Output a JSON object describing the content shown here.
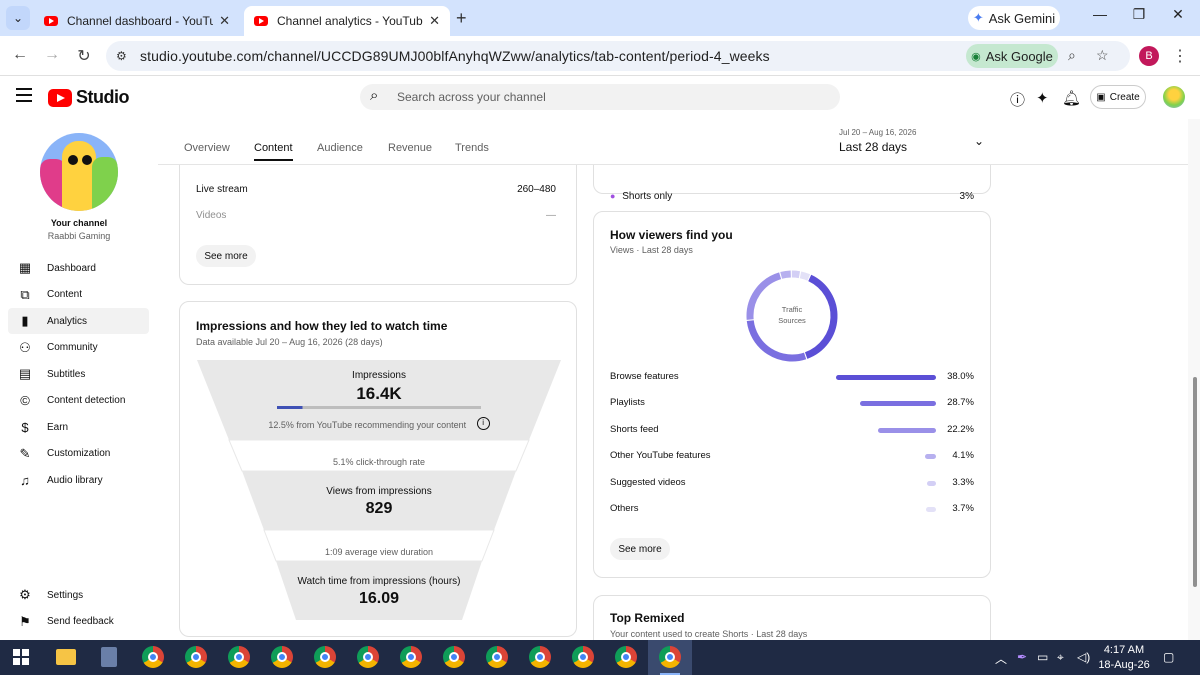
{
  "browser": {
    "tabs": [
      {
        "title": "Channel dashboard - YouTube Studio",
        "active": false
      },
      {
        "title": "Channel analytics - YouTube Studio",
        "active": true
      }
    ],
    "new_tab_icon": "plus-icon",
    "gemini_label": "Ask Gemini",
    "url": "studio.youtube.com/channel/UCCDG89UMJ00blfAnyhqWZww/analytics/tab-content/period-4_weeks",
    "ask_google_label": "Ask Google",
    "profile_initial": "B",
    "profile_color": "#c2185b"
  },
  "header": {
    "logo_text": "Studio",
    "search_placeholder": "Search across your channel",
    "create_label": "Create"
  },
  "sidebar": {
    "your_channel": "Your channel",
    "channel_name": "Raabbi Gaming",
    "items": [
      {
        "label": "Dashboard",
        "icon": "dashboard-icon"
      },
      {
        "label": "Content",
        "icon": "content-icon"
      },
      {
        "label": "Analytics",
        "icon": "analytics-icon",
        "active": true
      },
      {
        "label": "Community",
        "icon": "community-icon"
      },
      {
        "label": "Subtitles",
        "icon": "subtitles-icon"
      },
      {
        "label": "Content detection",
        "icon": "copyright-icon"
      },
      {
        "label": "Earn",
        "icon": "dollar-icon"
      },
      {
        "label": "Customization",
        "icon": "magic-wand-icon"
      },
      {
        "label": "Audio library",
        "icon": "audio-library-icon"
      }
    ],
    "bottom_items": [
      {
        "label": "Settings",
        "icon": "gear-icon"
      },
      {
        "label": "Send feedback",
        "icon": "feedback-icon"
      }
    ]
  },
  "analytics": {
    "tabs": [
      "Overview",
      "Content",
      "Audience",
      "Revenue",
      "Trends"
    ],
    "selected_tab": "Content",
    "period_range": "Jul 20 – Aug 16, 2026",
    "period_label": "Last 28 days"
  },
  "content_types": {
    "rows": [
      {
        "label": "Live stream",
        "value": "260–480"
      },
      {
        "label": "Videos",
        "value": "—"
      }
    ],
    "see_more": "See more"
  },
  "impressions": {
    "title": "Impressions and how they led to watch time",
    "subtitle": "Data available Jul 20 – Aug 16, 2026 (28 days)",
    "impressions_label": "Impressions",
    "impressions_value": "16.4K",
    "recommend_text": "12.5% from YouTube recommending your content",
    "recommend_fraction": 0.125,
    "ctr_text": "5.1% click-through rate",
    "views_label": "Views from impressions",
    "views_value": "829",
    "avd_text": "1:09 average view duration",
    "watch_label": "Watch time from impressions (hours)",
    "watch_value": "16.09"
  },
  "shorts_only": {
    "label": "Shorts only",
    "value": "3%"
  },
  "viewers": {
    "title": "How viewers find you",
    "subtitle": "Views · Last 28 days",
    "donut_label_1": "Traffic",
    "donut_label_2": "Sources",
    "sources": [
      {
        "label": "Browse features",
        "value": "38.0%",
        "pct": 38.0,
        "color": "#5b4fd6"
      },
      {
        "label": "Playlists",
        "value": "28.7%",
        "pct": 28.7,
        "color": "#7a6fe0"
      },
      {
        "label": "Shorts feed",
        "value": "22.2%",
        "pct": 22.2,
        "color": "#9a90e8"
      },
      {
        "label": "Other YouTube features",
        "value": "4.1%",
        "pct": 4.1,
        "color": "#b7b0ef"
      },
      {
        "label": "Suggested videos",
        "value": "3.3%",
        "pct": 3.3,
        "color": "#d3cff5"
      },
      {
        "label": "Others",
        "value": "3.7%",
        "pct": 3.7,
        "color": "#e3e1f7"
      }
    ],
    "see_more": "See more"
  },
  "remix": {
    "title": "Top Remixed",
    "subtitle": "Your content used to create Shorts · Last 28 days"
  },
  "taskbar": {
    "time": "4:17 AM",
    "date": "18-Aug-26"
  }
}
